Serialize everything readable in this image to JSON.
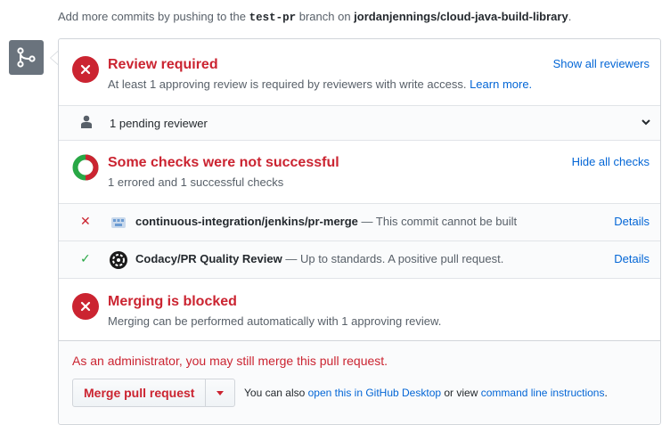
{
  "hint": {
    "prefix": "Add more commits by pushing to the ",
    "branch": "test-pr",
    "middle": " branch on ",
    "repo": "jordanjennings/cloud-java-build-library",
    "suffix": "."
  },
  "review": {
    "title": "Review required",
    "description": "At least 1 approving review is required by reviewers with write access.",
    "learn_more": "Learn more.",
    "show_all": "Show all reviewers",
    "pending": "1 pending reviewer"
  },
  "checks": {
    "title": "Some checks were not successful",
    "description": "1 errored and 1 successful checks",
    "hide_all": "Hide all checks",
    "items": [
      {
        "status": "error",
        "mark": "✕",
        "icon": "jenkins-icon",
        "context": "continuous-integration/jenkins/pr-merge",
        "description": " — This commit cannot be built",
        "details": "Details"
      },
      {
        "status": "success",
        "mark": "✓",
        "icon": "codacy-icon",
        "context": "Codacy/PR Quality Review",
        "description": " — Up to standards. A positive pull request.",
        "details": "Details"
      }
    ]
  },
  "blocked": {
    "title": "Merging is blocked",
    "description": "Merging can be performed automatically with 1 approving review."
  },
  "merge": {
    "admin_note": "As an administrator, you may still merge this pull request.",
    "button_label": "Merge pull request",
    "alt_prefix": "You can also ",
    "alt_desktop": "open this in GitHub Desktop",
    "alt_middle": " or view ",
    "alt_cli": "command line instructions",
    "alt_suffix": "."
  },
  "colors": {
    "error": "#cb2431",
    "success": "#28a745",
    "link": "#0366d6",
    "muted": "#586069"
  }
}
